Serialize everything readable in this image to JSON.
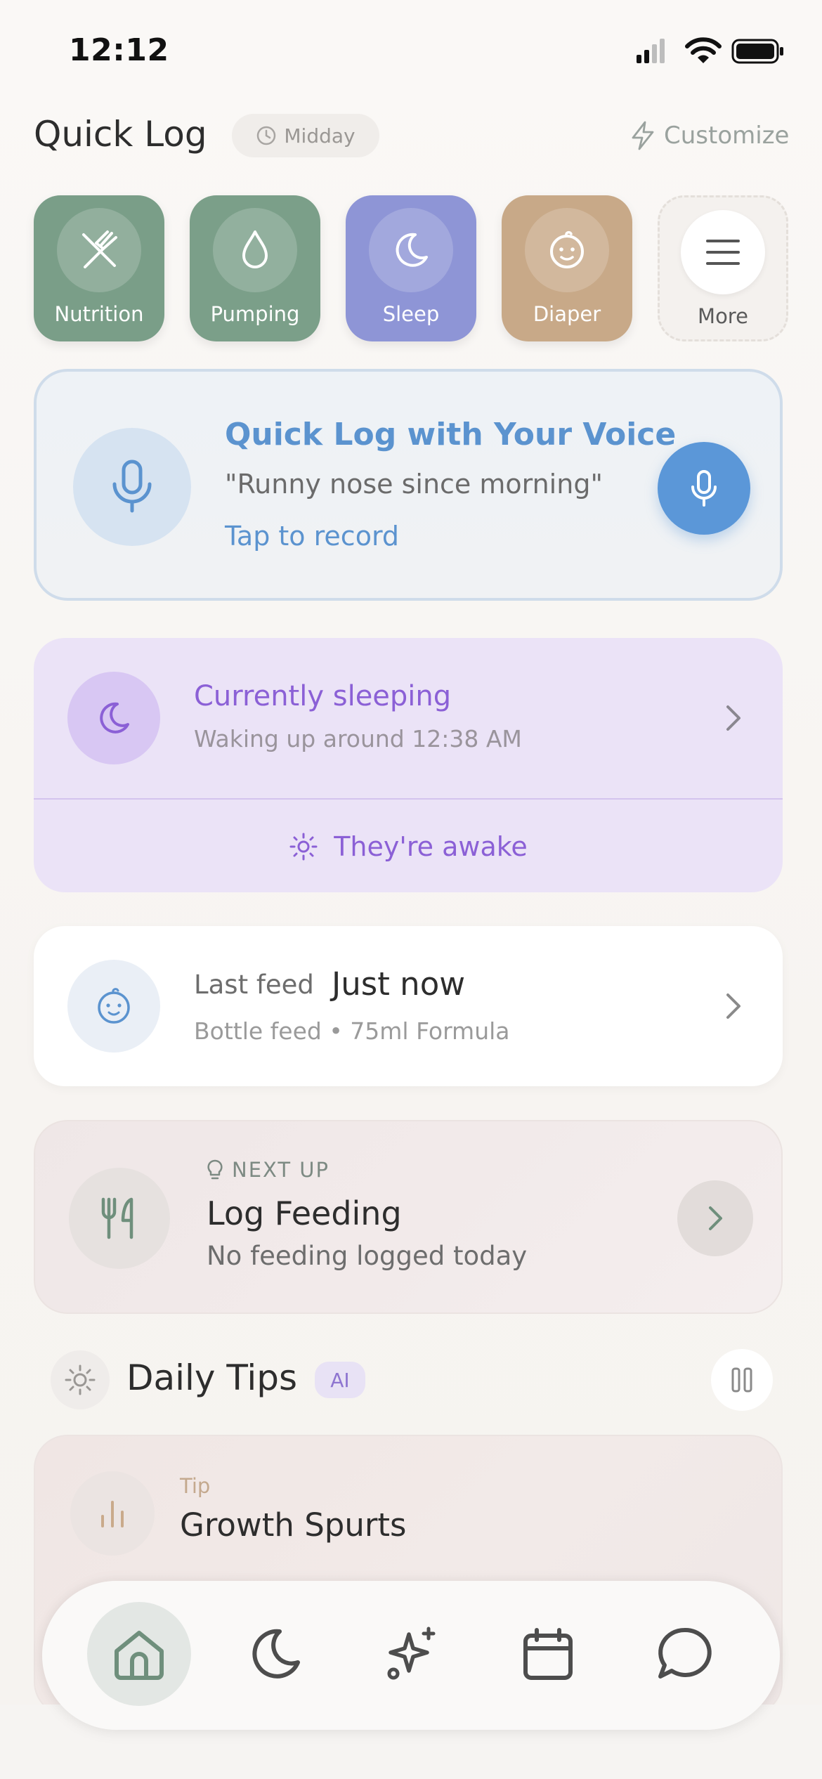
{
  "status_bar": {
    "time": "12:12"
  },
  "header": {
    "title": "Quick Log",
    "time_of_day": "Midday",
    "customize_label": "Customize"
  },
  "quick_log_tiles": [
    {
      "label": "Nutrition",
      "icon": "fork-knife-icon",
      "color": "#7a9e88"
    },
    {
      "label": "Pumping",
      "icon": "droplet-icon",
      "color": "#7b9f89"
    },
    {
      "label": "Sleep",
      "icon": "moon-icon",
      "color": "#8e95d6"
    },
    {
      "label": "Diaper",
      "icon": "baby-face-icon",
      "color": "#c8a988"
    },
    {
      "label": "More",
      "icon": "menu-icon",
      "color": "#f4f1ee"
    }
  ],
  "voice_card": {
    "title": "Quick Log with Your Voice",
    "example": "\"Runny nose since morning\"",
    "action": "Tap to record"
  },
  "sleep_card": {
    "title": "Currently sleeping",
    "subtitle": "Waking up around 12:38 AM",
    "awake_label": "They're awake"
  },
  "feed_card": {
    "label": "Last feed",
    "value": "Just now",
    "detail": "Bottle feed • 75ml Formula"
  },
  "next_up_card": {
    "eyebrow": "NEXT UP",
    "title": "Log Feeding",
    "subtitle": "No feeding logged today"
  },
  "daily_tips": {
    "title": "Daily Tips",
    "badge": "AI",
    "tip": {
      "eyebrow": "Tip",
      "title": "Growth Spurts"
    }
  },
  "bottom_nav": [
    {
      "name": "home",
      "icon": "home-icon",
      "active": true
    },
    {
      "name": "sleep",
      "icon": "moon-icon",
      "active": false
    },
    {
      "name": "ai",
      "icon": "sparkles-icon",
      "active": false
    },
    {
      "name": "calendar",
      "icon": "calendar-icon",
      "active": false
    },
    {
      "name": "chat",
      "icon": "chat-bubble-icon",
      "active": false
    }
  ]
}
